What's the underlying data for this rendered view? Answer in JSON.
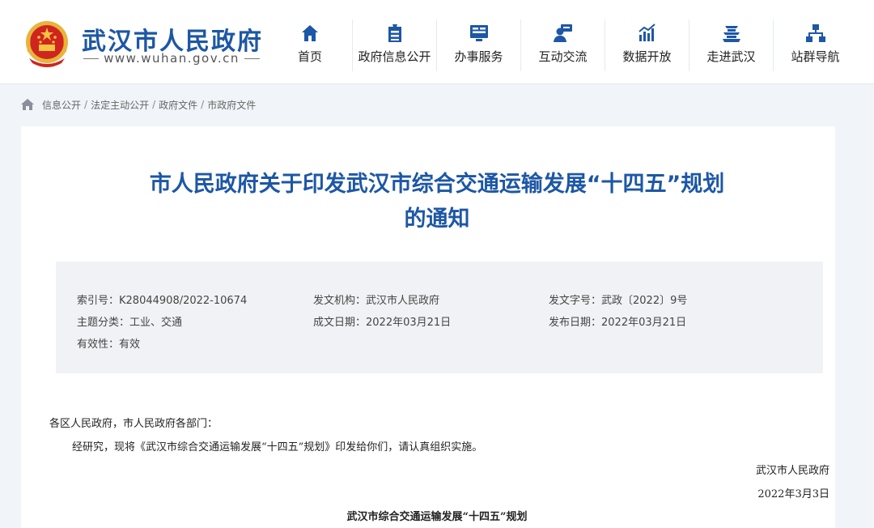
{
  "header": {
    "site_title": "武汉市人民政府",
    "site_url": "www.wuhan.gov.cn",
    "nav": [
      {
        "label": "首页",
        "icon": "home-icon"
      },
      {
        "label": "政府信息公开",
        "icon": "info-disclosure-icon"
      },
      {
        "label": "办事服务",
        "icon": "service-monitor-icon"
      },
      {
        "label": "互动交流",
        "icon": "interaction-user-icon"
      },
      {
        "label": "数据开放",
        "icon": "data-chart-icon"
      },
      {
        "label": "走进武汉",
        "icon": "tower-icon"
      },
      {
        "label": "站群导航",
        "icon": "sitemap-icon"
      }
    ]
  },
  "breadcrumb": [
    "信息公开",
    "法定主动公开",
    "政府文件",
    "市政府文件"
  ],
  "doc": {
    "title_line1": "市人民政府关于印发武汉市综合交通运输发展“十四五”规划",
    "title_line2": "的通知"
  },
  "meta": {
    "index_label": "索引号：",
    "index_value": "K28044908/2022-10674",
    "agency_label": "发文机构：",
    "agency_value": "武汉市人民政府",
    "doc_no_label": "发文字号：",
    "doc_no_value": "武政〔2022〕9号",
    "category_label": "主题分类：",
    "category_value": "工业、交通",
    "created_label": "成文日期：",
    "created_value": "2022年03月21日",
    "published_label": "发布日期：",
    "published_value": "2022年03月21日",
    "validity_label": "有效性：",
    "validity_value": "有效"
  },
  "content": {
    "salutation": "各区人民政府，市人民政府各部门：",
    "paragraph1": "经研究，现将《武汉市综合交通运输发展“十四五”规划》印发给你们，请认真组织实施。",
    "signature": "武汉市人民政府",
    "date": "2022年3月3日",
    "subtitle": "武汉市综合交通运输发展“十四五”规划"
  },
  "colors": {
    "brand_blue": "#1d57a5",
    "page_bg": "#f1f4f8",
    "meta_bg": "#f0f2f5"
  }
}
